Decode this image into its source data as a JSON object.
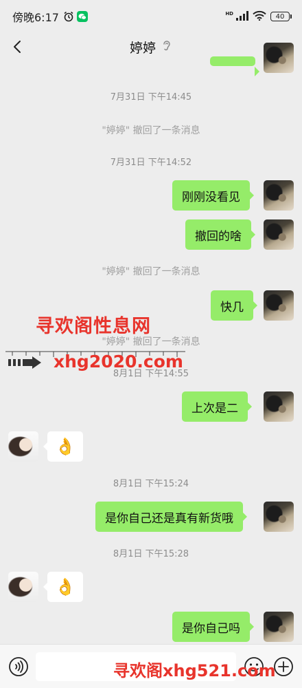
{
  "status_bar": {
    "time": "傍晚6:17",
    "network_label": "HD",
    "battery": "40",
    "icons": [
      "alarm-icon",
      "wechat-icon",
      "signal-icon",
      "wifi-icon",
      "battery-icon"
    ]
  },
  "header": {
    "title": "婷婷",
    "icons": [
      "back-arrow-icon",
      "ear-icon",
      "more-icon"
    ]
  },
  "messages": [
    {
      "type": "time",
      "text": "7月31日 下午14:45"
    },
    {
      "type": "system",
      "text": "\"婷婷\" 撤回了一条消息"
    },
    {
      "type": "time",
      "text": "7月31日 下午14:52"
    },
    {
      "type": "sent",
      "text": "刚刚没看见"
    },
    {
      "type": "sent",
      "text": "撤回的啥"
    },
    {
      "type": "system",
      "text": "\"婷婷\" 撤回了一条消息"
    },
    {
      "type": "sent",
      "text": "快几"
    },
    {
      "type": "system",
      "text": "\"婷婷\" 撤回了一条消息"
    },
    {
      "type": "time",
      "text": "8月1日 下午14:55"
    },
    {
      "type": "sent",
      "text": "上次是二"
    },
    {
      "type": "received",
      "text": "👌"
    },
    {
      "type": "time",
      "text": "8月1日 下午15:24"
    },
    {
      "type": "sent",
      "text": "是你自己还是真有新货哦"
    },
    {
      "type": "time",
      "text": "8月1日 下午15:28"
    },
    {
      "type": "received",
      "text": "👌"
    },
    {
      "type": "sent",
      "text": "是你自己吗"
    }
  ],
  "watermark": {
    "title": "寻欢阁性息网",
    "site": "xhg2020.com",
    "bottom": "寻欢阁xhg521.com"
  },
  "input_bar": {
    "placeholder": "",
    "icons": [
      "voice-icon",
      "emoji-icon",
      "plus-icon"
    ]
  },
  "colors": {
    "background": "#ededed",
    "sent_bubble": "#95ec69",
    "received_bubble": "#ffffff",
    "watermark": "#e8342c"
  }
}
